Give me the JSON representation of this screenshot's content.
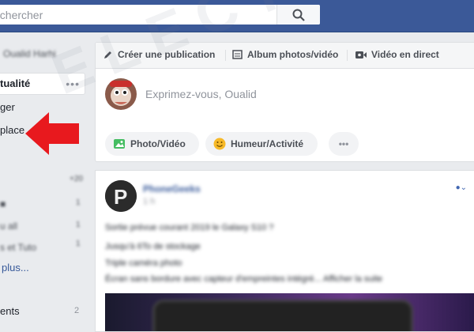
{
  "search": {
    "placeholder": "echercher"
  },
  "sidebar": {
    "items": [
      {
        "label": "Oualid Harhi"
      },
      {
        "label": "tualité"
      },
      {
        "label": "ger"
      },
      {
        "label": "place"
      },
      {
        "label": "+20"
      },
      {
        "label": "1"
      },
      {
        "label": "1"
      },
      {
        "label": "1"
      },
      {
        "label": "s et Tuto"
      },
      {
        "label": "plus..."
      },
      {
        "label": "ents"
      },
      {
        "label": "2"
      }
    ]
  },
  "composer": {
    "tabs": [
      {
        "label": "Créer une publication",
        "icon": "pencil-icon"
      },
      {
        "label": "Album photos/vidéo",
        "icon": "album-icon"
      },
      {
        "label": "Vidéo en direct",
        "icon": "live-video-icon"
      }
    ],
    "placeholder": "Exprimez-vous, Oualid",
    "actions": [
      {
        "label": "Photo/Vidéo",
        "icon": "photo-icon",
        "color": "#45bd62"
      },
      {
        "label": "Humeur/Activité",
        "icon": "smiley-icon",
        "color": "#f7b928"
      },
      {
        "label": "•••",
        "icon": "more-icon"
      }
    ]
  },
  "post": {
    "author": "PhoneGeeks",
    "meta": "1 h",
    "lines": [
      "Sortie prévue courant 2019 le Galaxy S10 ?",
      "Jusqu'à 6To de stockage",
      "Triple caméra photo",
      "Écran sans bordure avec capteur d'empreintes intégré... Afficher la suite"
    ]
  },
  "watermark": "ELECTRODZ.COM",
  "colors": {
    "topbar": "#3b5998",
    "arrow": "#e8191e",
    "background": "#e9ebee"
  }
}
